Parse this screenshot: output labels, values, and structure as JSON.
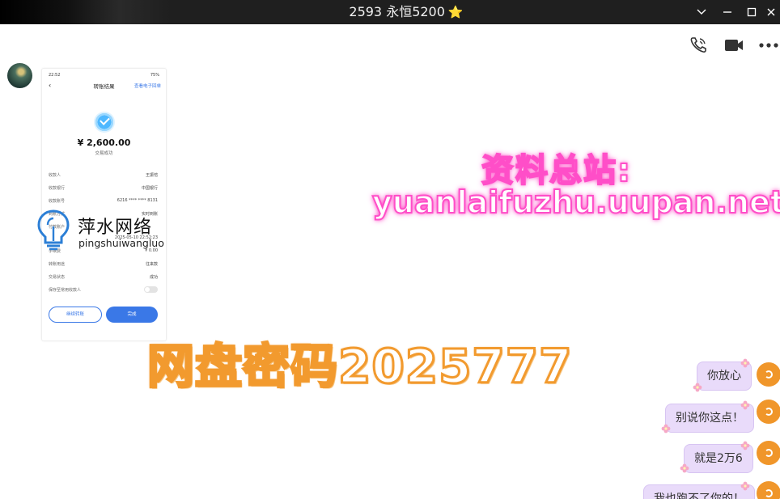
{
  "titlebar": {
    "title": "2593 永恒5200",
    "star": "⭐"
  },
  "toolbar": {
    "icons": [
      "phone-icon",
      "video-icon",
      "more-icon"
    ]
  },
  "phone_screenshot": {
    "status_time": "22:52",
    "status_right": "75%",
    "header_title": "转账结果",
    "header_link": "查看电子回单",
    "amount": "¥ 2,600.00",
    "status": "交易成功",
    "rows": [
      {
        "label": "收款人",
        "value": "王振恺"
      },
      {
        "label": "收款银行",
        "value": "中国银行"
      },
      {
        "label": "收款账号",
        "value": "6216 **** **** 8131"
      },
      {
        "label": "到账方式",
        "value": "实时到账"
      },
      {
        "label": "付款账户",
        "value": ""
      },
      {
        "label": "",
        "value": "2025-05-10 22:52:23"
      },
      {
        "label": "手续费",
        "value": "¥ 0.00"
      },
      {
        "label": "转账用途",
        "value": "往来款"
      },
      {
        "label": "交易状态",
        "value": "成功"
      },
      {
        "label": "保存至常用收款人",
        "value": ""
      }
    ],
    "btn_continue": "继续转账",
    "btn_done": "完成"
  },
  "watermark": {
    "name": "萍水网络",
    "pinyin": "pingshuiwangluo"
  },
  "promo": {
    "line1": "资料总站:",
    "line2": "yuanlaifuzhu.uupan.net",
    "line3": "网盘密码2025777"
  },
  "messages": [
    {
      "text": "你放心"
    },
    {
      "text": "别说你这点！"
    },
    {
      "text": "就是2万6"
    },
    {
      "text": "我也跑不了你的！"
    }
  ],
  "colors": {
    "titlebar_bg": "#1f1f1f",
    "bubble_bg": "#e9dbfa",
    "promo_pink": "#ff4ec8",
    "promo_orange": "#f29a2e",
    "avatar_orange": "#f0962a",
    "bank_blue": "#3a78e7"
  }
}
